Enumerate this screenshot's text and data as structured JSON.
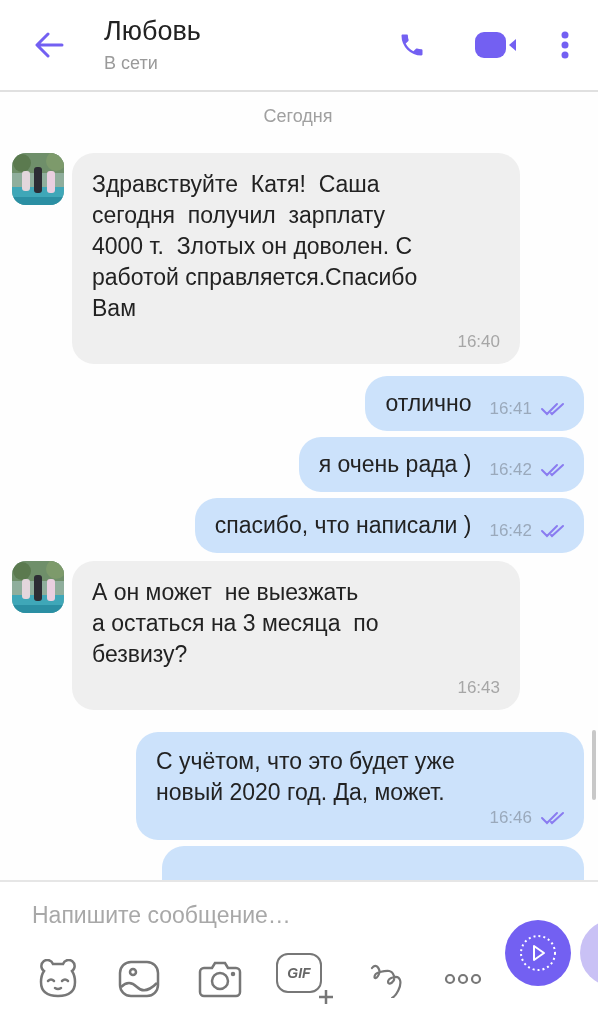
{
  "header": {
    "title": "Любовь",
    "status": "В сети"
  },
  "date_label": "Сегодня",
  "messages": [
    {
      "kind": "incoming",
      "text": "Здравствуйте  Катя!  Саша\nсегодня  получил  зарплату\n4000 т.  Злотых он доволен. С\nработой справляется.Спасибо\nВам",
      "time": "16:40"
    },
    {
      "kind": "outgoing",
      "text": "отлично",
      "time": "16:41",
      "read": true
    },
    {
      "kind": "outgoing",
      "text": "я очень рада )",
      "time": "16:42",
      "read": true
    },
    {
      "kind": "outgoing",
      "text": "спасибо, что написали )",
      "time": "16:42",
      "read": true
    },
    {
      "kind": "incoming",
      "text": "А он может  не выезжать\nа остаться на 3 месяца  по\nбезвизу?",
      "time": "16:43"
    },
    {
      "kind": "outgoing_long",
      "text": "С учётом, что это будет уже\nновый 2020 год. Да, может.",
      "time": "16:46",
      "read": true
    },
    {
      "kind": "outgoing_cut"
    }
  ],
  "composer": {
    "placeholder": "Напишите сообщение…",
    "gif_label": "GIF"
  }
}
